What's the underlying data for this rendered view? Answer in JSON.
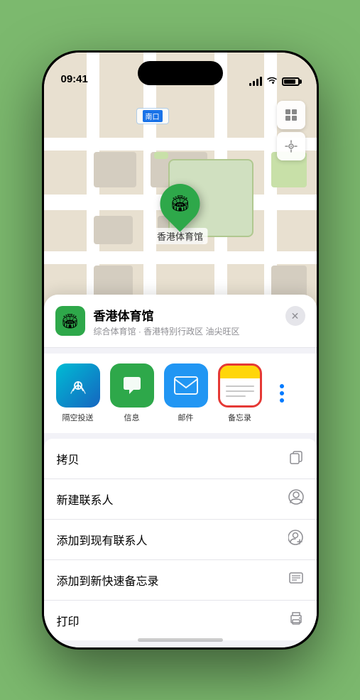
{
  "status_bar": {
    "time": "09:41",
    "location_arrow": "▶"
  },
  "map": {
    "location_label": "南口",
    "marker_label": "香港体育馆",
    "marker_emoji": "🏟"
  },
  "venue": {
    "name": "香港体育馆",
    "subtitle": "综合体育馆 · 香港特别行政区 油尖旺区",
    "icon_emoji": "🏟"
  },
  "share_items": [
    {
      "label": "隔空投送",
      "type": "airdrop",
      "icon": "📡"
    },
    {
      "label": "信息",
      "type": "messages",
      "icon": "💬"
    },
    {
      "label": "邮件",
      "type": "mail",
      "icon": "✉"
    },
    {
      "label": "备忘录",
      "type": "notes",
      "selected": true
    }
  ],
  "action_items": [
    {
      "label": "拷贝",
      "icon": "⧉"
    },
    {
      "label": "新建联系人",
      "icon": "👤"
    },
    {
      "label": "添加到现有联系人",
      "icon": "👤"
    },
    {
      "label": "添加到新快速备忘录",
      "icon": "📋"
    },
    {
      "label": "打印",
      "icon": "🖨"
    }
  ],
  "buttons": {
    "close": "✕"
  }
}
